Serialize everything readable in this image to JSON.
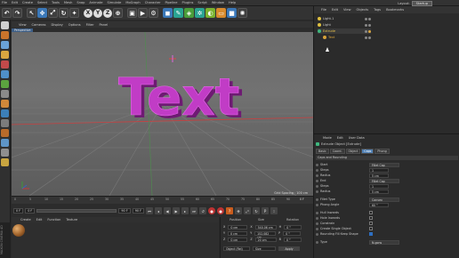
{
  "menu": [
    "File",
    "Edit",
    "Create",
    "Select",
    "Tools",
    "Mesh",
    "Snap",
    "Animate",
    "Simulate",
    "MoGraph",
    "Character",
    "Pipeline",
    "Plugins",
    "Script",
    "Window",
    "Help"
  ],
  "layout_label": "Layout:",
  "layout_value": "Startup",
  "toolbar": {
    "axes": [
      "X",
      "Y",
      "Z"
    ],
    "icons": [
      "undo-icon",
      "redo-icon",
      "live-select-icon",
      "move-icon",
      "scale-icon",
      "rotate-icon",
      "coordinate-system-icon",
      "render-region-icon",
      "render-view-icon",
      "render-settings-icon",
      "cube-icon",
      "pen-icon",
      "subdivision-icon",
      "array-icon",
      "deformer-icon",
      "floor-icon",
      "camera-icon",
      "light-icon"
    ]
  },
  "viewport": {
    "menu": [
      "View",
      "Cameras",
      "Display",
      "Options",
      "Filter",
      "Panel"
    ],
    "tab": "Perspective",
    "text_object": "Text",
    "grid_spacing": "Grid Spacing : 100 cm"
  },
  "timeline": {
    "ticks": [
      "0",
      "5",
      "10",
      "15",
      "20",
      "25",
      "30",
      "35",
      "40",
      "45",
      "50",
      "55",
      "60",
      "65",
      "70",
      "75",
      "80",
      "85",
      "90"
    ],
    "end_frame": "0 F",
    "start_field": "0 F",
    "current_field": "0 F",
    "max_field": "90 F",
    "end_field": "90 F"
  },
  "materials": {
    "menu": [
      "Create",
      "Edit",
      "Function",
      "Texture"
    ],
    "logo": "MAXON CINEMA 4D"
  },
  "coordinates": {
    "headers": [
      "Position",
      "Size",
      "Rotation"
    ],
    "rows": [
      {
        "axis": "X",
        "pos": "0 cm",
        "axis2": "X",
        "size": "540.06 cm",
        "axis3": "H",
        "rot": "0 °"
      },
      {
        "axis": "Y",
        "pos": "0 cm",
        "axis2": "Y",
        "size": "152.082 cm",
        "axis3": "P",
        "rot": "0 °"
      },
      {
        "axis": "Z",
        "pos": "0 cm",
        "axis2": "Z",
        "size": "20 cm",
        "axis3": "B",
        "rot": "0 °"
      }
    ],
    "mode_select": "Object (Rel)",
    "size_select": "Size",
    "apply": "Apply"
  },
  "object_manager": {
    "menu": [
      "File",
      "Edit",
      "View",
      "Objects",
      "Tags",
      "Bookmarks"
    ],
    "items": [
      {
        "name": "Light.1",
        "color": "#e0c040",
        "selected": false,
        "indent": 0
      },
      {
        "name": "Light",
        "color": "#e0c040",
        "selected": false,
        "indent": 0
      },
      {
        "name": "Extrude",
        "color": "#3fb77e",
        "selected": true,
        "indent": 0
      },
      {
        "name": "Text",
        "color": "#d7a23a",
        "selected": false,
        "indent": 1
      }
    ]
  },
  "attributes": {
    "menu": [
      "Mode",
      "Edit",
      "User Data"
    ],
    "object_title": "Extrude Object [Extrude]",
    "tabs": [
      {
        "label": "Basic",
        "active": false
      },
      {
        "label": "Coord.",
        "active": false
      },
      {
        "label": "Object",
        "active": false
      },
      {
        "label": "Caps",
        "active": true
      },
      {
        "label": "Phong",
        "active": false
      }
    ],
    "section": "Caps and Rounding",
    "props": [
      {
        "label": "Start",
        "value": "Fillet Cap",
        "wide": true
      },
      {
        "label": "Steps",
        "value": "1",
        "wide": false
      },
      {
        "label": "Radius",
        "value": "5 cm",
        "wide": false
      },
      {
        "label": "End",
        "value": "Fillet Cap",
        "wide": true
      },
      {
        "label": "Steps",
        "value": "1",
        "wide": false
      },
      {
        "label": "Radius",
        "value": "5 cm",
        "wide": false
      },
      {
        "label": "Fillet Type",
        "value": "Convex",
        "wide": true
      },
      {
        "label": "Phong Angle",
        "value": "60 °",
        "wide": false
      },
      {
        "label": "Hull Inwards",
        "check": false
      },
      {
        "label": "Hole Inwards",
        "check": false
      },
      {
        "label": "Constrain",
        "check": false
      },
      {
        "label": "Create Single Object",
        "check": false
      },
      {
        "label": "Rounding Fill Keep Shape",
        "check": true
      },
      {
        "label": "Type",
        "value": "N-gons",
        "wide": true
      }
    ]
  },
  "colors": {
    "text_extrude": "#c13cc6",
    "text_extrude_dark": "#6e1a73",
    "selection_blue": "#4f7fb3",
    "axis_x": "#d03030",
    "axis_y": "#40a040",
    "axis_z": "#3060d0"
  }
}
